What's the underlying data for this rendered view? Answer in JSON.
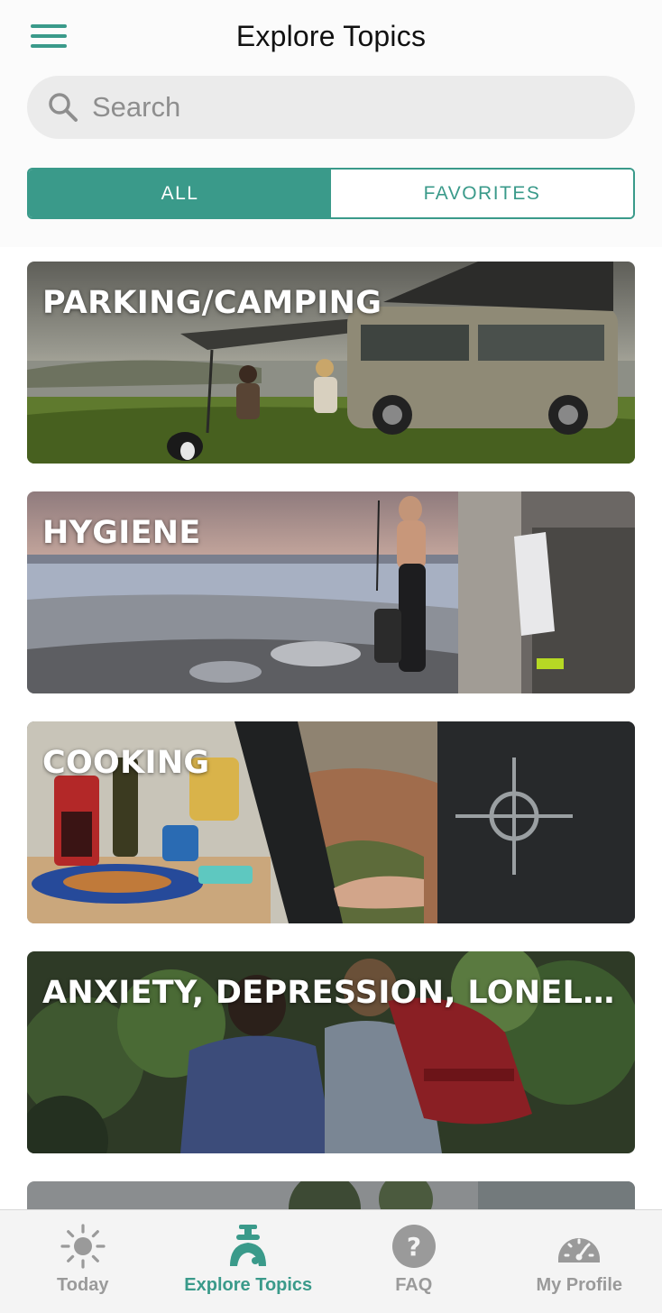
{
  "header": {
    "title": "Explore Topics",
    "menu_icon": "hamburger-menu-icon"
  },
  "search": {
    "placeholder": "Search",
    "value": "",
    "icon": "search-icon"
  },
  "segments": [
    {
      "label": "ALL",
      "active": true
    },
    {
      "label": "FAVORITES",
      "active": false
    }
  ],
  "topics": [
    {
      "label": "PARKING/CAMPING"
    },
    {
      "label": "HYGIENE"
    },
    {
      "label": "COOKING"
    },
    {
      "label": "ANXIETY, DEPRESSION, LONELI..."
    }
  ],
  "tabs": [
    {
      "label": "Today",
      "icon": "sun-icon",
      "active": false
    },
    {
      "label": "Explore Topics",
      "icon": "explore-topics-icon",
      "active": true
    },
    {
      "label": "FAQ",
      "icon": "question-icon",
      "active": false
    },
    {
      "label": "My Profile",
      "icon": "speedometer-icon",
      "active": false
    }
  ],
  "colors": {
    "accent": "#3a9a8a",
    "inactive_tab": "#9a9a9a",
    "tab_bar_bg": "#f4f4f4"
  }
}
